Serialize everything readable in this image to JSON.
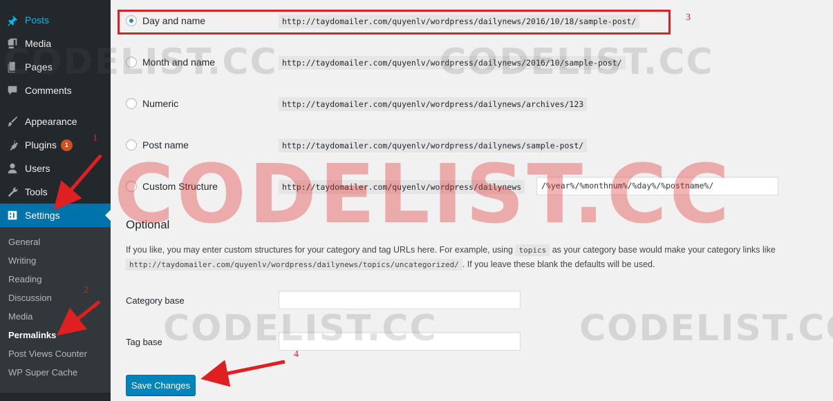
{
  "sidebar": {
    "menu": [
      {
        "label": "Posts",
        "icon": "pin-icon"
      },
      {
        "label": "Media",
        "icon": "media-icon"
      },
      {
        "label": "Pages",
        "icon": "pages-icon"
      },
      {
        "label": "Comments",
        "icon": "comments-icon"
      },
      {
        "label": "Appearance",
        "icon": "brush-icon"
      },
      {
        "label": "Plugins",
        "icon": "plug-icon",
        "badge": "1"
      },
      {
        "label": "Users",
        "icon": "user-icon"
      },
      {
        "label": "Tools",
        "icon": "wrench-icon"
      },
      {
        "label": "Settings",
        "icon": "settings-icon"
      }
    ],
    "submenu": [
      "General",
      "Writing",
      "Reading",
      "Discussion",
      "Media",
      "Permalinks",
      "Post Views Counter",
      "WP Super Cache"
    ]
  },
  "permalinks": {
    "options": [
      {
        "label": "Day and name",
        "example": "http://taydomailer.com/quyenlv/wordpress/dailynews/2016/10/18/sample-post/",
        "checked": true
      },
      {
        "label": "Month and name",
        "example": "http://taydomailer.com/quyenlv/wordpress/dailynews/2016/10/sample-post/",
        "checked": false
      },
      {
        "label": "Numeric",
        "example": "http://taydomailer.com/quyenlv/wordpress/dailynews/archives/123",
        "checked": false
      },
      {
        "label": "Post name",
        "example": "http://taydomailer.com/quyenlv/wordpress/dailynews/sample-post/",
        "checked": false
      },
      {
        "label": "Custom Structure",
        "example": "http://taydomailer.com/quyenlv/wordpress/dailynews",
        "checked": false
      }
    ],
    "custom_structure_value": "/%year%/%monthnum%/%day%/%postname%/"
  },
  "optional": {
    "heading": "Optional",
    "text_1": "If you like, you may enter custom structures for your category and tag URLs here. For example, using",
    "code_1": "topics",
    "text_2": "as your category base would make your category links like",
    "code_2": "http://taydomailer.com/quyenlv/wordpress/dailynews/topics/uncategorized/",
    "text_3": ". If you leave these blank the defaults will be used.",
    "category_base_label": "Category base",
    "tag_base_label": "Tag base",
    "category_base_value": "",
    "tag_base_value": ""
  },
  "save_label": "Save Changes",
  "annotations": [
    "1",
    "2",
    "3",
    "4"
  ],
  "watermark": "CODELIST.CC",
  "colors": {
    "highlight": "#e02020",
    "accent": "#0073aa",
    "button": "#0085ba"
  }
}
